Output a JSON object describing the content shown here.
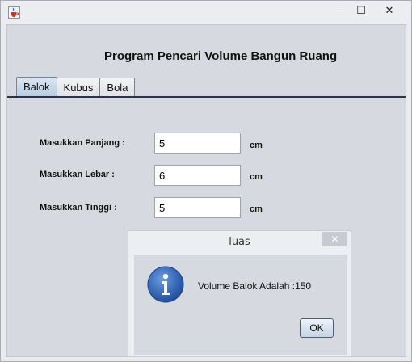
{
  "window": {
    "icon": "java-cup-icon",
    "controls": {
      "minimize": "–",
      "maximize": "☐",
      "close": "✕"
    }
  },
  "page_title": "Program Pencari Volume Bangun Ruang",
  "tabs": [
    {
      "label": "Balok",
      "selected": true
    },
    {
      "label": "Kubus",
      "selected": false
    },
    {
      "label": "Bola",
      "selected": false
    }
  ],
  "form": {
    "fields": [
      {
        "label": "Masukkan Panjang :",
        "value": "5",
        "unit": "cm"
      },
      {
        "label": "Masukkan Lebar :",
        "value": "6",
        "unit": "cm"
      },
      {
        "label": "Masukkan Tinggi :",
        "value": "5",
        "unit": "cm"
      }
    ]
  },
  "dialog": {
    "title": "luas",
    "close": "✕",
    "icon": "info-icon",
    "message": "Volume Balok Adalah :150",
    "ok_label": "OK"
  },
  "colors": {
    "info_icon_blue": "#2f63b3",
    "tab_underline": "#2b3446"
  }
}
